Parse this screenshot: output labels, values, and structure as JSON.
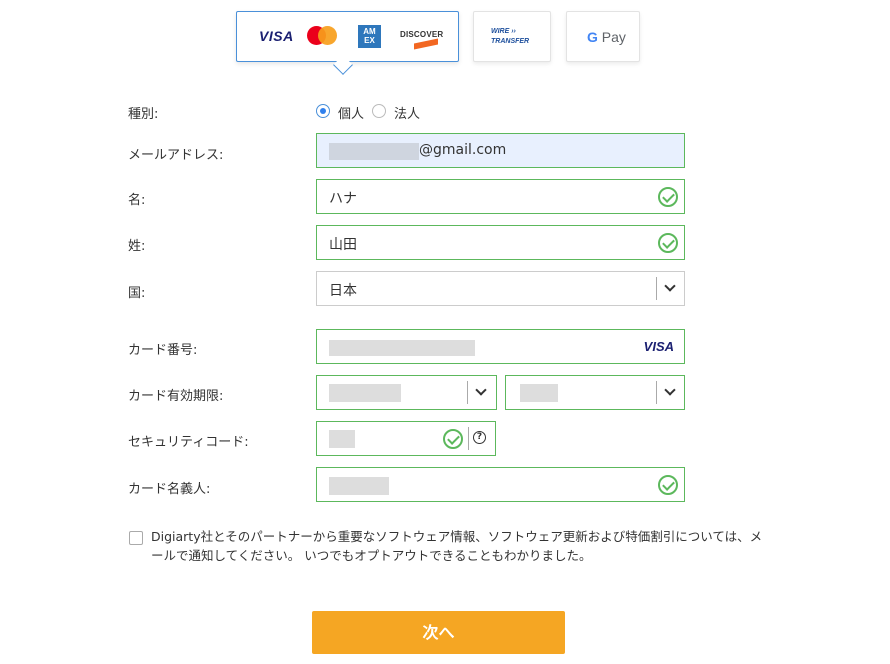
{
  "payment_methods": {
    "cards": {
      "visa": "VISA",
      "amex": "AMERICAN EXPRESS",
      "discover": "DISCOVER"
    },
    "wire_transfer": {
      "line1": "WIRE",
      "line2": "TRANSFER"
    },
    "gpay": {
      "g": "G",
      "pay": "Pay"
    }
  },
  "form": {
    "type": {
      "label": "種別:",
      "options": [
        "個人",
        "法人"
      ],
      "selected": "個人"
    },
    "email": {
      "label": "メールアドレス:",
      "visible_value": "@gmail.com",
      "bg_color": "#e8f0fe"
    },
    "first_name": {
      "label": "名:",
      "value": "ハナ"
    },
    "last_name": {
      "label": "姓:",
      "value": "山田"
    },
    "country": {
      "label": "国:",
      "value": "日本"
    },
    "card_number": {
      "label": "カード番号:",
      "brand": "VISA"
    },
    "card_expiry": {
      "label": "カード有効期限:"
    },
    "security_code": {
      "label": "セキュリティコード:",
      "help": "?"
    },
    "card_holder": {
      "label": "カード名義人:"
    }
  },
  "consent": {
    "text": "Digiarty社とそのパートナーから重要なソフトウェア情報、ソフトウェア更新および特価割引については、メールで通知してください。 いつでもオプトアウトできることもわかりました。",
    "checked": false
  },
  "next_button": {
    "label": "次へ",
    "color": "#f5a623"
  },
  "colors": {
    "valid_border": "#5cb85c",
    "active_tab_border": "#4a90d9"
  }
}
